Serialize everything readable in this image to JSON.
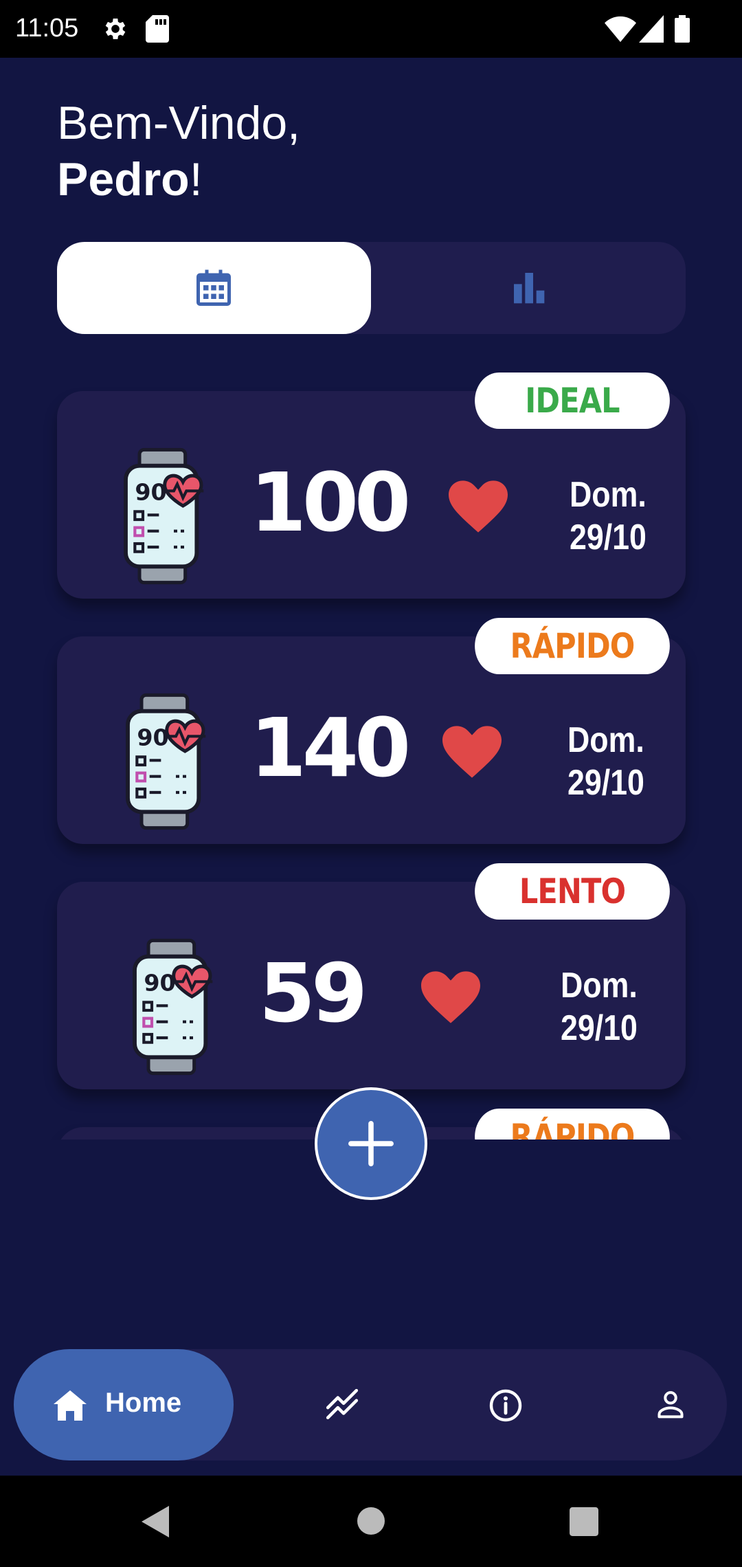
{
  "status_bar": {
    "time": "11:05"
  },
  "greeting": {
    "line1": "Bem-Vindo,",
    "name": "Pedro",
    "suffix": "!"
  },
  "tabs": [
    {
      "icon": "calendar-icon",
      "active": true
    },
    {
      "icon": "bar-chart-icon",
      "active": false
    }
  ],
  "readings": [
    {
      "status": "IDEAL",
      "status_color": "#3aaa4a",
      "bpm": "100",
      "day": "Dom.",
      "date": "29/10"
    },
    {
      "status": "RÁPIDO",
      "status_color": "#ec7a1c",
      "bpm": "140",
      "day": "Dom.",
      "date": "29/10"
    },
    {
      "status": "LENTO",
      "status_color": "#d9312e",
      "bpm": "59",
      "day": "Dom.",
      "date": "29/10"
    },
    {
      "status": "RÁPIDO",
      "status_color": "#ec7a1c"
    }
  ],
  "fab": {
    "icon": "plus-icon"
  },
  "bottom_nav": {
    "home_label": "Home",
    "items": [
      "home-icon",
      "trend-icon",
      "info-icon",
      "profile-icon"
    ]
  },
  "colors": {
    "background": "#121542",
    "card": "#201d4d",
    "accent": "#3f64b0",
    "heart": "#e04848"
  }
}
